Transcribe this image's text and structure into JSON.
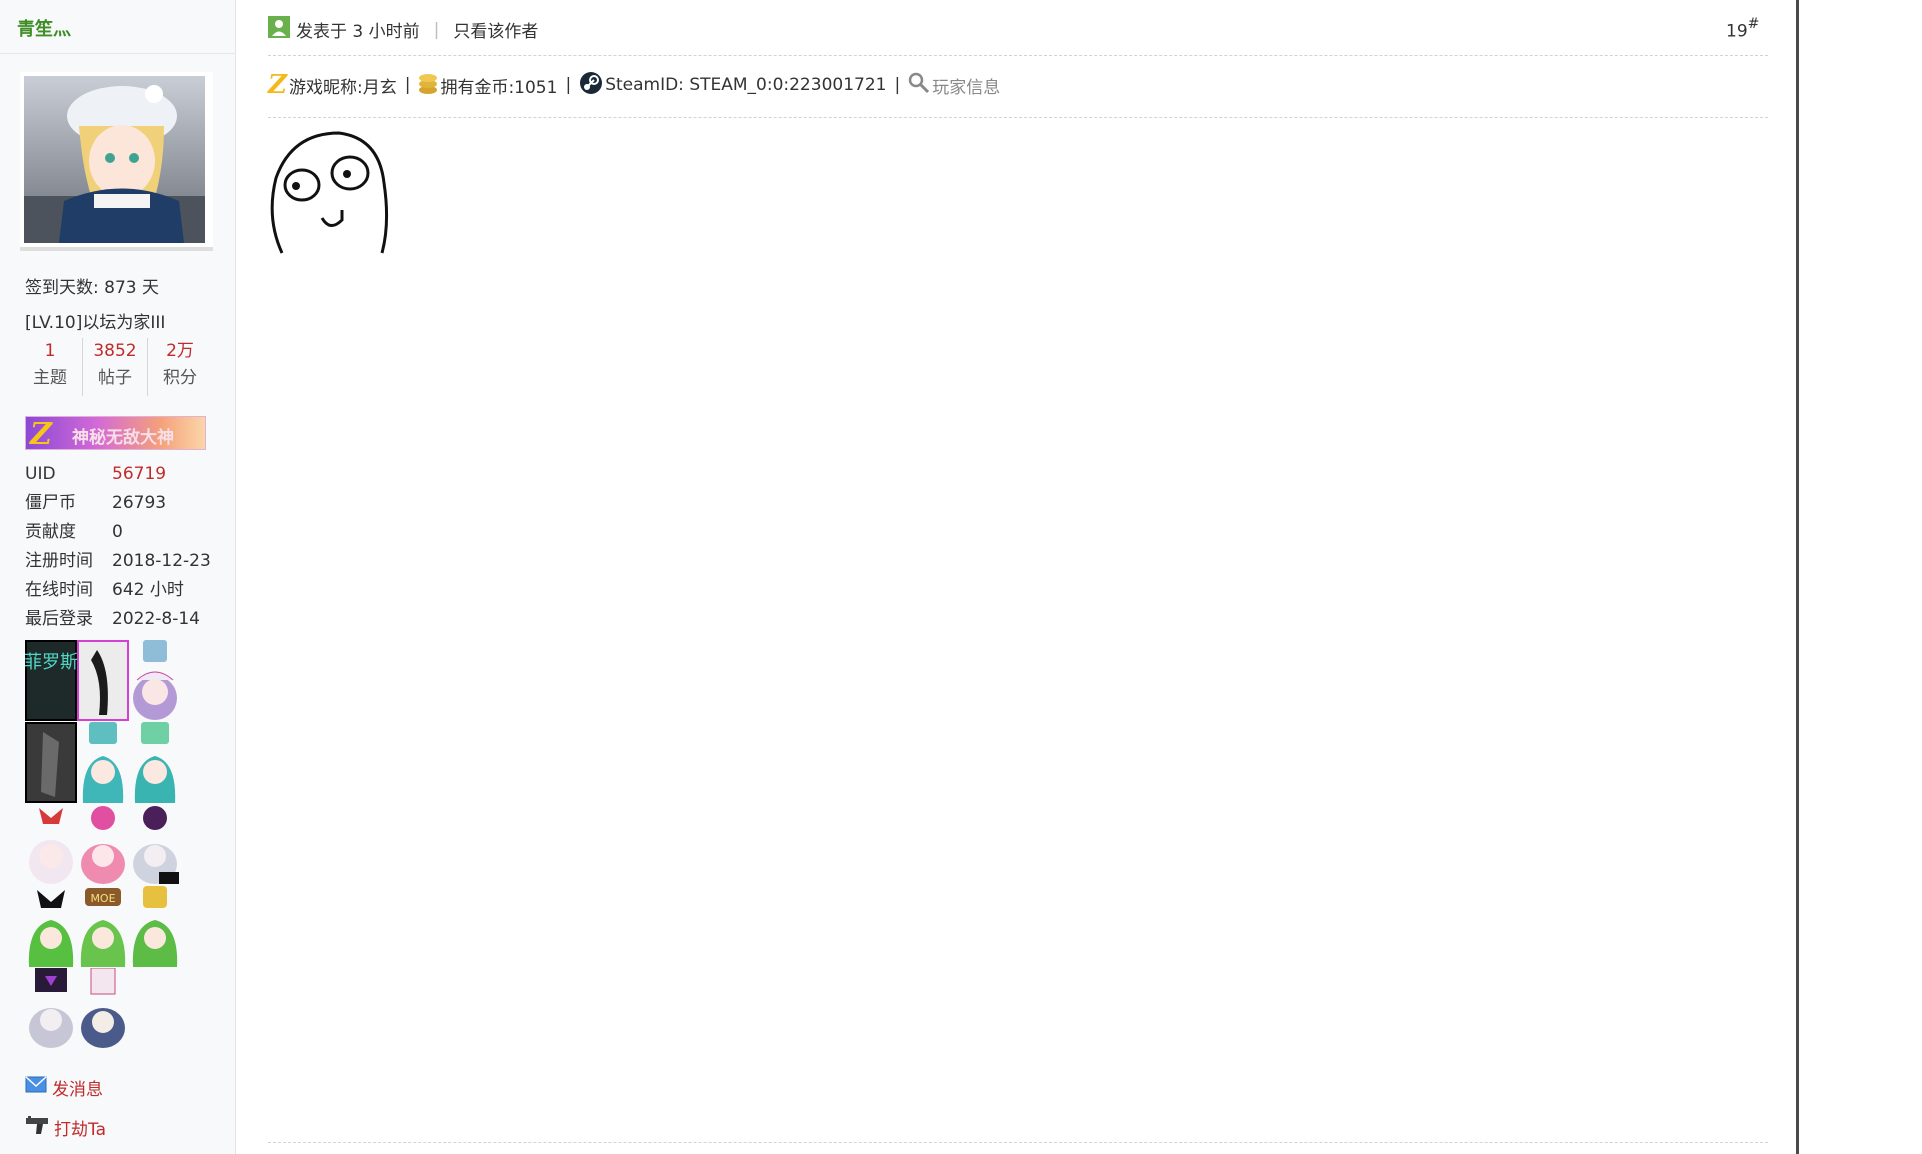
{
  "user": {
    "name": "青笙灬",
    "signin_days": "签到天数: 873 天",
    "level": "[LV.10]以坛为家III",
    "stats": [
      {
        "num": "1",
        "label": "主题"
      },
      {
        "num": "3852",
        "label": "帖子"
      },
      {
        "num": "2万",
        "label": "积分"
      }
    ],
    "medal_bar_text": "神秘无敌大神",
    "profile": [
      {
        "key": "UID",
        "value": "56719"
      },
      {
        "key": "僵尸币",
        "value": "26793"
      },
      {
        "key": "贡献度",
        "value": "0"
      },
      {
        "key": "注册时间",
        "value": "2018-12-23"
      },
      {
        "key": "在线时间",
        "value": "642 小时"
      },
      {
        "key": "最后登录",
        "value": "2022-8-14"
      }
    ],
    "medal_text": "菲罗斯",
    "send_message": "发消息",
    "rob": "打劫Ta"
  },
  "post": {
    "posted": "发表于 3 小时前",
    "only_author": "只看该作者",
    "floor": "19",
    "floor_mark": "#",
    "game_nick": "游戏昵称:月玄",
    "coins": "拥有金币:1051",
    "steam_id": "SteamID: STEAM_0:0:223001721",
    "player_info": "玩家信息",
    "pipe": "|"
  },
  "colors": {
    "username": "#3e8e26",
    "accent_red": "#c12b2b"
  }
}
